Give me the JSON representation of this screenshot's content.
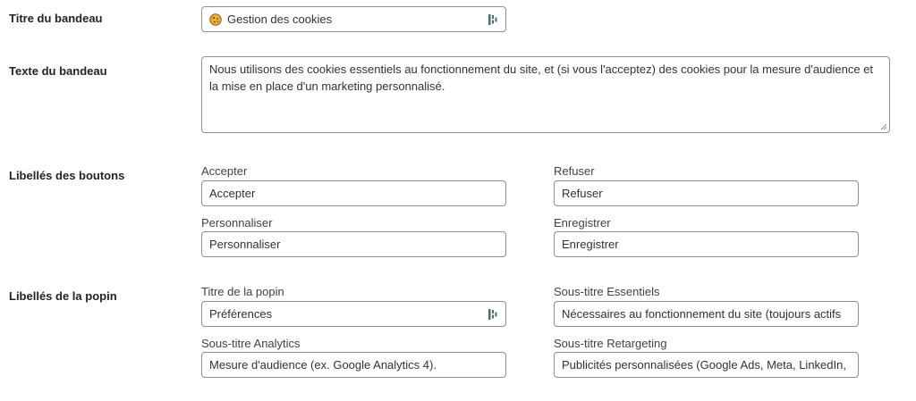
{
  "banner_title": {
    "label": "Titre du bandeau",
    "value": "Gestion des cookies",
    "icon": "cookie-icon",
    "extension_icon": "password-manager-icon"
  },
  "banner_text": {
    "label": "Texte du bandeau",
    "value": "Nous utilisons des cookies essentiels au fonctionnement du site, et (si vous l'acceptez) des cookies pour la mesure d'audience et la mise en place d'un marketing personnalisé."
  },
  "button_labels": {
    "label": "Libellés des boutons",
    "accept": {
      "label": "Accepter",
      "value": "Accepter"
    },
    "refuse": {
      "label": "Refuser",
      "value": "Refuser"
    },
    "customize": {
      "label": "Personnaliser",
      "value": "Personnaliser"
    },
    "save": {
      "label": "Enregistrer",
      "value": "Enregistrer"
    }
  },
  "popin_labels": {
    "label": "Libellés de la popin",
    "title": {
      "label": "Titre de la popin",
      "value": "Préférences",
      "extension_icon": "password-manager-icon"
    },
    "essentials": {
      "label": "Sous-titre Essentiels",
      "value": "Nécessaires au fonctionnement du site (toujours actifs"
    },
    "analytics": {
      "label": "Sous-titre Analytics",
      "value": "Mesure d'audience (ex. Google Analytics 4)."
    },
    "retargeting": {
      "label": "Sous-titre Retargeting",
      "value": "Publicités personnalisées (Google Ads, Meta, LinkedIn,"
    }
  },
  "colors": {
    "border": "#8c8f94",
    "text": "#1d2327",
    "cookie_icon": "#e0a526",
    "extension_icon": "#4a6d7a"
  }
}
